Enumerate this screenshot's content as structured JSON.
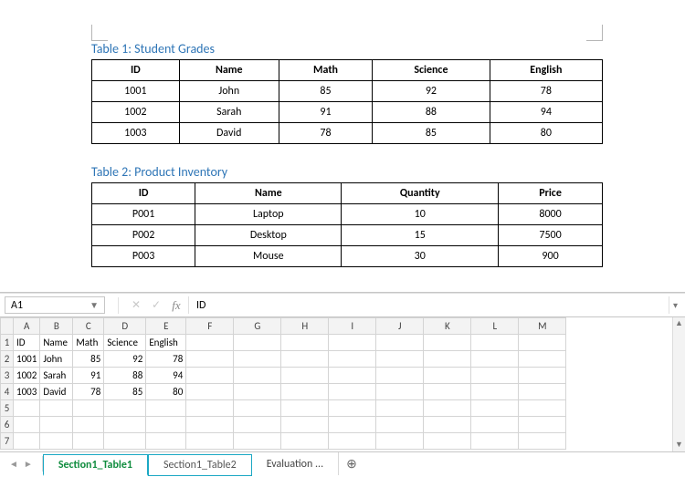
{
  "doc": {
    "table1": {
      "title": "Table 1: Student Grades",
      "headers": [
        "ID",
        "Name",
        "Math",
        "Science",
        "English"
      ],
      "rows": [
        [
          "1001",
          "John",
          "85",
          "92",
          "78"
        ],
        [
          "1002",
          "Sarah",
          "91",
          "88",
          "94"
        ],
        [
          "1003",
          "David",
          "78",
          "85",
          "80"
        ]
      ]
    },
    "table2": {
      "title": "Table 2: Product Inventory",
      "headers": [
        "ID",
        "Name",
        "Quantity",
        "Price"
      ],
      "rows": [
        [
          "P001",
          "Laptop",
          "10",
          "8000"
        ],
        [
          "P002",
          "Desktop",
          "15",
          "7500"
        ],
        [
          "P003",
          "Mouse",
          "30",
          "900"
        ]
      ]
    }
  },
  "excel": {
    "namebox": "A1",
    "formula_value": "ID",
    "col_headers": [
      "A",
      "B",
      "C",
      "D",
      "E",
      "F",
      "G",
      "H",
      "I",
      "J",
      "K",
      "L",
      "M"
    ],
    "row_headers": [
      "1",
      "2",
      "3",
      "4",
      "5",
      "6",
      "7"
    ],
    "cells": {
      "r1": [
        "ID",
        "Name",
        "Math",
        "Science",
        "English"
      ],
      "r2": [
        "1001",
        "John",
        "85",
        "92",
        "78"
      ],
      "r3": [
        "1002",
        "Sarah",
        "91",
        "88",
        "94"
      ],
      "r4": [
        "1003",
        "David",
        "78",
        "85",
        "80"
      ]
    },
    "tabs": {
      "active": "Section1_Table1",
      "second": "Section1_Table2",
      "third": "Evaluation  ..."
    }
  }
}
